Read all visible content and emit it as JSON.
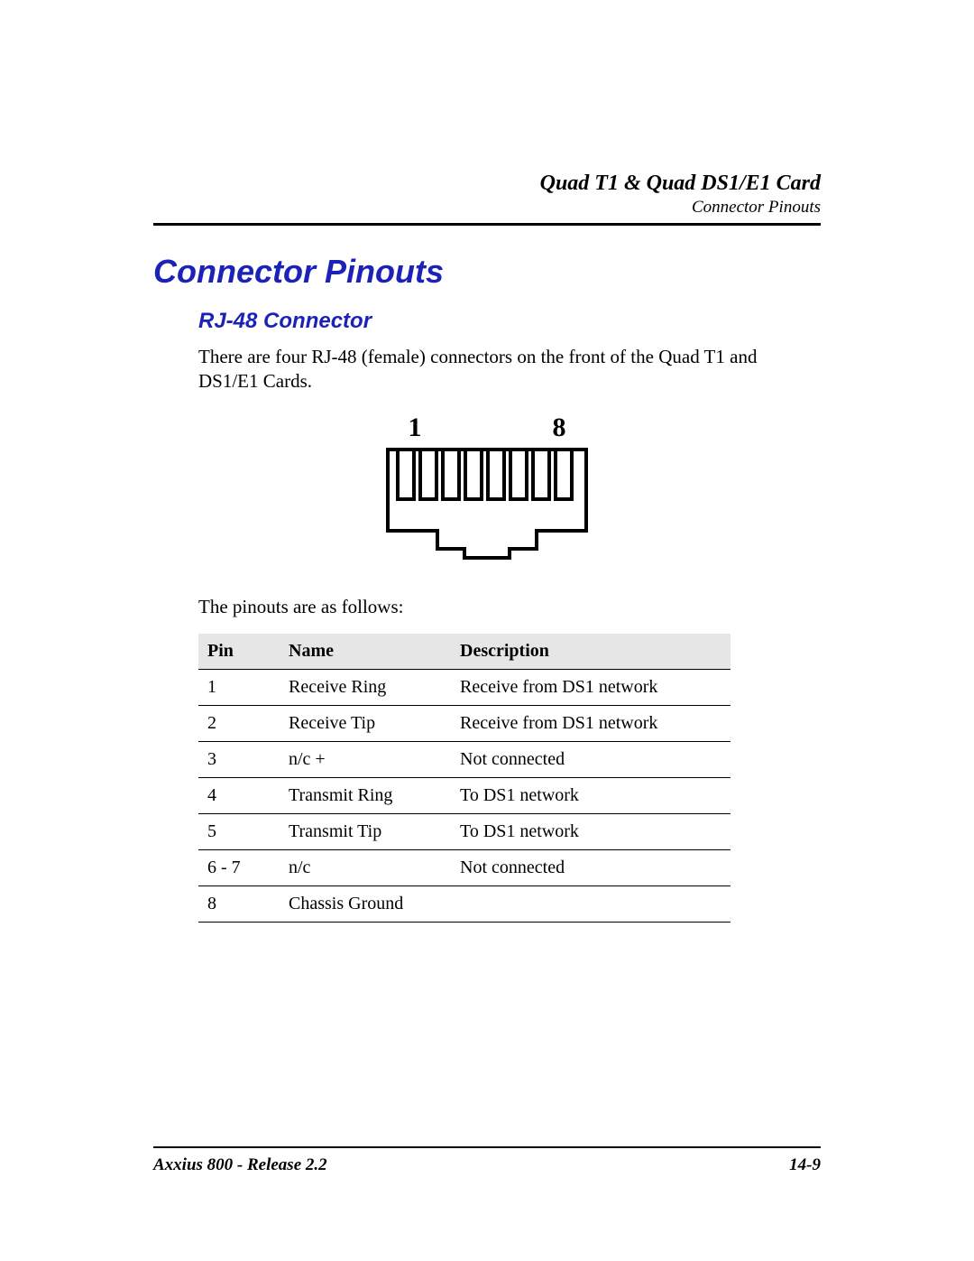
{
  "header": {
    "title": "Quad T1 & Quad DS1/E1 Card",
    "subtitle": "Connector Pinouts"
  },
  "section": {
    "h1": "Connector Pinouts",
    "h2": "RJ-48 Connector",
    "intro": "There are four RJ-48 (female) connectors on the front of the Quad T1 and DS1/E1 Cards.",
    "followup": "The pinouts are as follows:"
  },
  "diagram": {
    "label_left": "1",
    "label_right": "8"
  },
  "table": {
    "headers": [
      "Pin",
      "Name",
      "Description"
    ],
    "rows": [
      {
        "pin": "1",
        "name": "Receive Ring",
        "desc": "Receive from DS1 network"
      },
      {
        "pin": "2",
        "name": "Receive Tip",
        "desc": "Receive from DS1 network"
      },
      {
        "pin": "3",
        "name": "n/c +",
        "desc": "Not connected"
      },
      {
        "pin": "4",
        "name": "Transmit Ring",
        "desc": "To DS1 network"
      },
      {
        "pin": "5",
        "name": "Transmit Tip",
        "desc": "To DS1 network"
      },
      {
        "pin": "6 - 7",
        "name": "n/c",
        "desc": "Not connected"
      },
      {
        "pin": "8",
        "name": "Chassis Ground",
        "desc": ""
      }
    ]
  },
  "footer": {
    "left": "Axxius 800 - Release 2.2",
    "right": "14-9"
  }
}
